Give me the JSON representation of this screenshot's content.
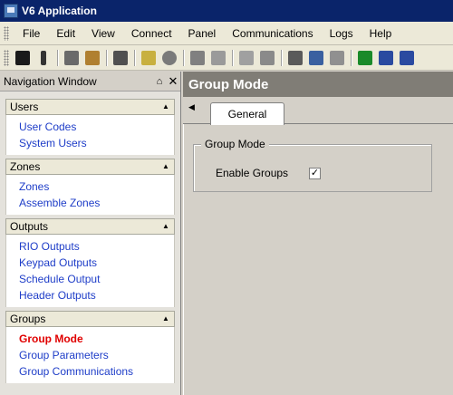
{
  "app": {
    "title": "V6 Application"
  },
  "menu": {
    "items": [
      "File",
      "Edit",
      "View",
      "Connect",
      "Panel",
      "Communications",
      "Logs",
      "Help"
    ]
  },
  "toolbar": {
    "buttons": [
      {
        "name": "save-icon",
        "color": "#1a1a1a"
      },
      {
        "name": "attach-icon",
        "color": "#333333"
      },
      {
        "name": "copy-icon",
        "color": "#6a6a6a"
      },
      {
        "name": "paste-icon",
        "color": "#b08030"
      },
      {
        "name": "print-icon",
        "color": "#505050"
      },
      {
        "name": "connect-icon",
        "color": "#c8b040"
      },
      {
        "name": "user-icon",
        "color": "#7a7a7a"
      },
      {
        "name": "modem-icon",
        "color": "#808080"
      },
      {
        "name": "device-icon",
        "color": "#9a9a9a"
      },
      {
        "name": "panel-icon",
        "color": "#a0a0a0"
      },
      {
        "name": "grid-icon",
        "color": "#8a8a8a"
      },
      {
        "name": "report-icon",
        "color": "#5a5a5a"
      },
      {
        "name": "users-icon",
        "color": "#3a60a0"
      },
      {
        "name": "calendar-icon",
        "color": "#909090"
      },
      {
        "name": "arrow-left-icon",
        "color": "#1a8a2a"
      },
      {
        "name": "list-icon",
        "color": "#2a4aa0"
      },
      {
        "name": "arrow-right-icon",
        "color": "#2a4aa0"
      }
    ]
  },
  "nav": {
    "title": "Navigation Window",
    "groups": [
      {
        "label": "Users",
        "items": [
          "User Codes",
          "System Users"
        ]
      },
      {
        "label": "Zones",
        "items": [
          "Zones",
          "Assemble Zones"
        ]
      },
      {
        "label": "Outputs",
        "items": [
          "RIO Outputs",
          "Keypad Outputs",
          "Schedule Output",
          "Header Outputs"
        ]
      },
      {
        "label": "Groups",
        "items": [
          "Group Mode",
          "Group Parameters",
          "Group Communications"
        ]
      }
    ],
    "active_item": "Group Mode"
  },
  "main": {
    "title": "Group Mode",
    "tab": "General",
    "groupbox": {
      "legend": "Group Mode",
      "field_label": "Enable Groups",
      "checked": true
    }
  },
  "colors": {
    "titlebar": "#0a246a",
    "link": "#1e3dc8",
    "active_link": "#e00000",
    "main_header": "#807d76"
  }
}
